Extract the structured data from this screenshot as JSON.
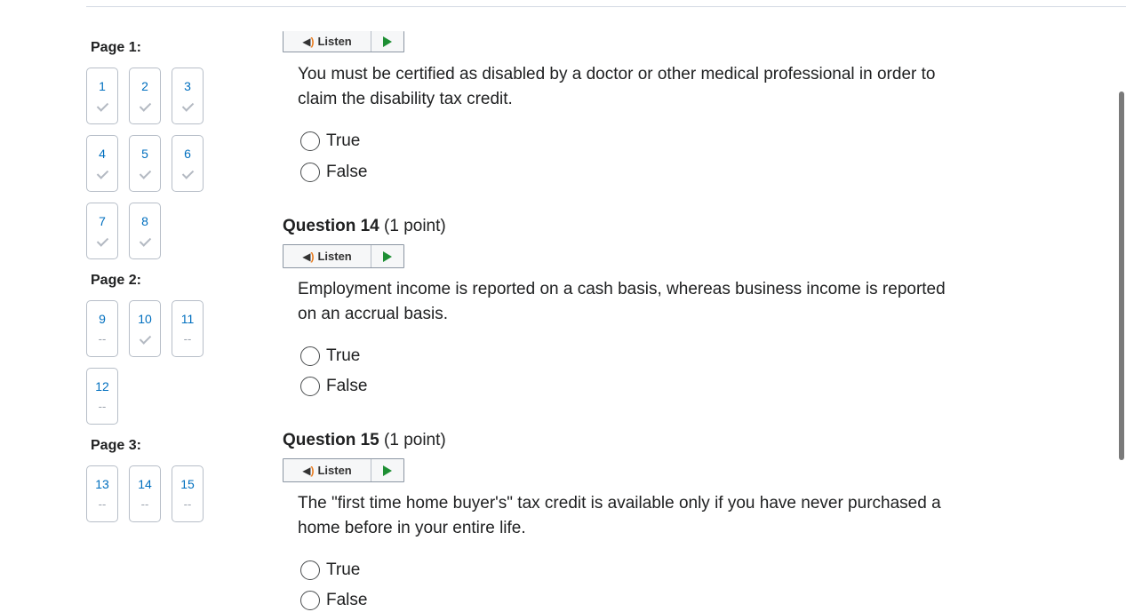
{
  "nav": {
    "pages": [
      {
        "label": "Page 1:",
        "questions": [
          {
            "num": "1",
            "status": "answered"
          },
          {
            "num": "2",
            "status": "answered"
          },
          {
            "num": "3",
            "status": "answered"
          },
          {
            "num": "4",
            "status": "answered"
          },
          {
            "num": "5",
            "status": "answered"
          },
          {
            "num": "6",
            "status": "answered"
          },
          {
            "num": "7",
            "status": "answered"
          },
          {
            "num": "8",
            "status": "answered"
          }
        ]
      },
      {
        "label": "Page 2:",
        "questions": [
          {
            "num": "9",
            "status": "unanswered"
          },
          {
            "num": "10",
            "status": "answered"
          },
          {
            "num": "11",
            "status": "unanswered"
          },
          {
            "num": "12",
            "status": "unanswered"
          }
        ]
      },
      {
        "label": "Page 3:",
        "questions": [
          {
            "num": "13",
            "status": "unanswered"
          },
          {
            "num": "14",
            "status": "unanswered"
          },
          {
            "num": "15",
            "status": "unanswered"
          }
        ]
      }
    ],
    "unanswered_mark": "--"
  },
  "listen_label": "Listen",
  "questions": [
    {
      "title": "",
      "points": "",
      "text": "You must be certified as disabled by a doctor or other medical professional in order to claim the disability tax credit.",
      "options": [
        "True",
        "False"
      ]
    },
    {
      "title": "Question 14",
      "points": "(1 point)",
      "text": "Employment income is reported on a cash basis, whereas business income is reported on an accrual basis.",
      "options": [
        "True",
        "False"
      ]
    },
    {
      "title": "Question 15",
      "points": "(1 point)",
      "text": "The \"first time home buyer's\" tax credit is available only if you have never purchased a home before in your entire life.",
      "options": [
        "True",
        "False"
      ]
    }
  ],
  "colors": {
    "link": "#006fbf",
    "play": "#1e8f34",
    "speaker_waves": "#e87b1e"
  }
}
